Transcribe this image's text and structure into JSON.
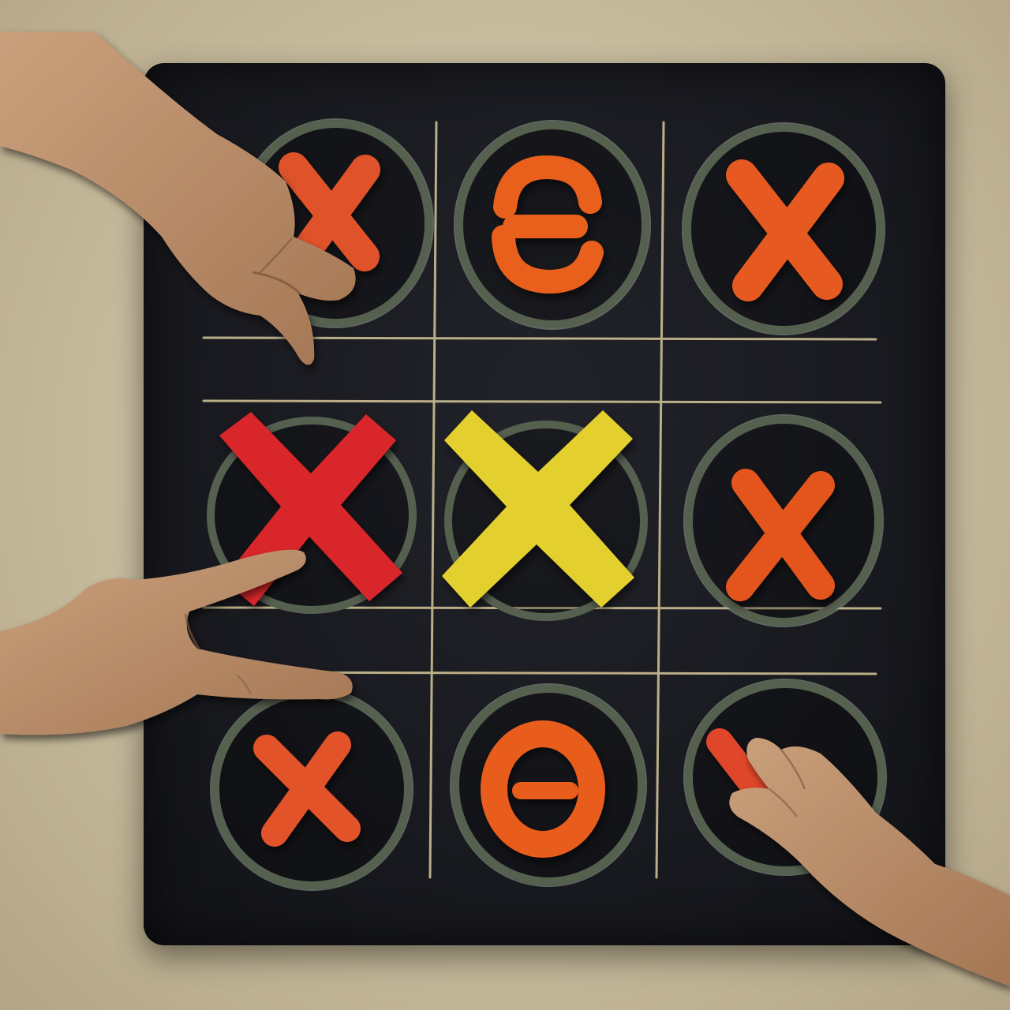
{
  "game": {
    "board_color": "#17181d",
    "grid_line_color": "#d6c89a",
    "table_color": "#c9bd9f",
    "cells": [
      {
        "row": 1,
        "col": 1,
        "piece": "x",
        "piece_color": "#e0522a",
        "ring": true,
        "covered_by": "hand"
      },
      {
        "row": 1,
        "col": 2,
        "piece": "e-shape",
        "piece_color": "#e8611f",
        "ring": true
      },
      {
        "row": 1,
        "col": 3,
        "piece": "x",
        "piece_color": "#e65a22",
        "ring": true
      },
      {
        "row": 2,
        "col": 1,
        "piece": "x",
        "piece_color": "#d9252c",
        "ring": true,
        "size": "large"
      },
      {
        "row": 2,
        "col": 2,
        "piece": "x",
        "piece_color": "#e3cf2e",
        "ring": true,
        "size": "large"
      },
      {
        "row": 2,
        "col": 3,
        "piece": "x",
        "piece_color": "#e3551f",
        "ring": true
      },
      {
        "row": 3,
        "col": 1,
        "piece": "x",
        "piece_color": "#e2532a",
        "ring": true
      },
      {
        "row": 3,
        "col": 2,
        "piece": "theta-shape",
        "piece_color": "#e85d1c",
        "ring": true
      },
      {
        "row": 3,
        "col": 3,
        "piece": "x",
        "piece_color": "#e0472a",
        "ring": true,
        "covered_by": "hand"
      }
    ],
    "hands": [
      "top-left-hand",
      "left-pointing-hand",
      "bottom-right-hand"
    ]
  }
}
